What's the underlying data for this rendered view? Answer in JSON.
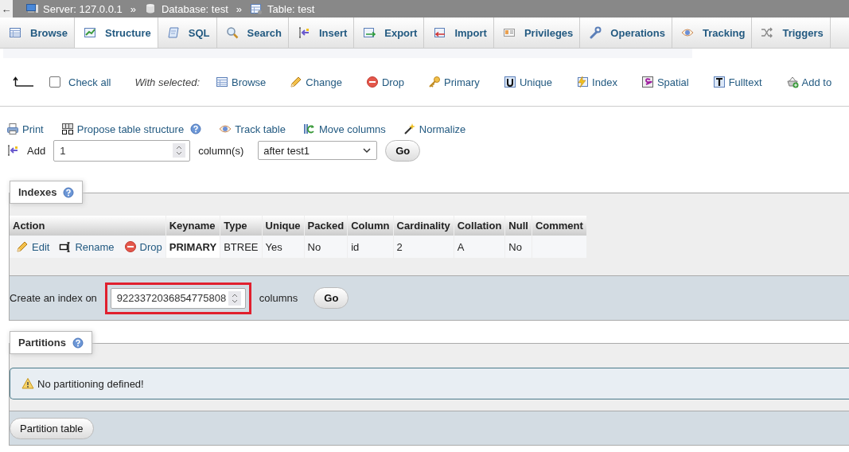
{
  "breadcrumb": {
    "back": "←",
    "crumbs": [
      {
        "label": "Server: 127.0.0.1",
        "separator": "»"
      },
      {
        "label": "Database: test",
        "separator": "»"
      },
      {
        "label": "Table: test"
      }
    ]
  },
  "tabs": [
    {
      "label": "Browse",
      "selected": false
    },
    {
      "label": "Structure",
      "selected": true
    },
    {
      "label": "SQL",
      "selected": false
    },
    {
      "label": "Search",
      "selected": false
    },
    {
      "label": "Insert",
      "selected": false
    },
    {
      "label": "Export",
      "selected": false
    },
    {
      "label": "Import",
      "selected": false
    },
    {
      "label": "Privileges",
      "selected": false
    },
    {
      "label": "Operations",
      "selected": false
    },
    {
      "label": "Tracking",
      "selected": false
    },
    {
      "label": "Triggers",
      "selected": false
    }
  ],
  "bulk_actions": {
    "check_all": {
      "label": "Check all",
      "checked": false
    },
    "with_selected": "With selected:",
    "actions": [
      "Browse",
      "Change",
      "Drop",
      "Primary",
      "Unique",
      "Index",
      "Spatial",
      "Fulltext",
      "Add to"
    ]
  },
  "tools": [
    "Print",
    "Propose table structure",
    "Track table",
    "Move columns",
    "Normalize"
  ],
  "add_columns": {
    "label": "Add",
    "count": "1",
    "unit": "column(s)",
    "position": "after test1",
    "button": "Go"
  },
  "indexes": {
    "title": "Indexes",
    "columns": [
      "Action",
      "Keyname",
      "Type",
      "Unique",
      "Packed",
      "Column",
      "Cardinality",
      "Collation",
      "Null",
      "Comment"
    ],
    "rows": [
      {
        "cells": [
          {
            "links": [
              "Edit",
              "Rename",
              "Drop"
            ]
          },
          "PRIMARY",
          "BTREE",
          "Yes",
          "No",
          "id",
          "2",
          "A",
          "No"
        ]
      }
    ]
  },
  "create_index": {
    "label": "Create an index on",
    "value": "9223372036854775808",
    "unit": "columns",
    "button": "Go",
    "highlighted": true
  },
  "partitions": {
    "title": "Partitions",
    "message": "No partitioning defined!",
    "button": "Partition table"
  }
}
